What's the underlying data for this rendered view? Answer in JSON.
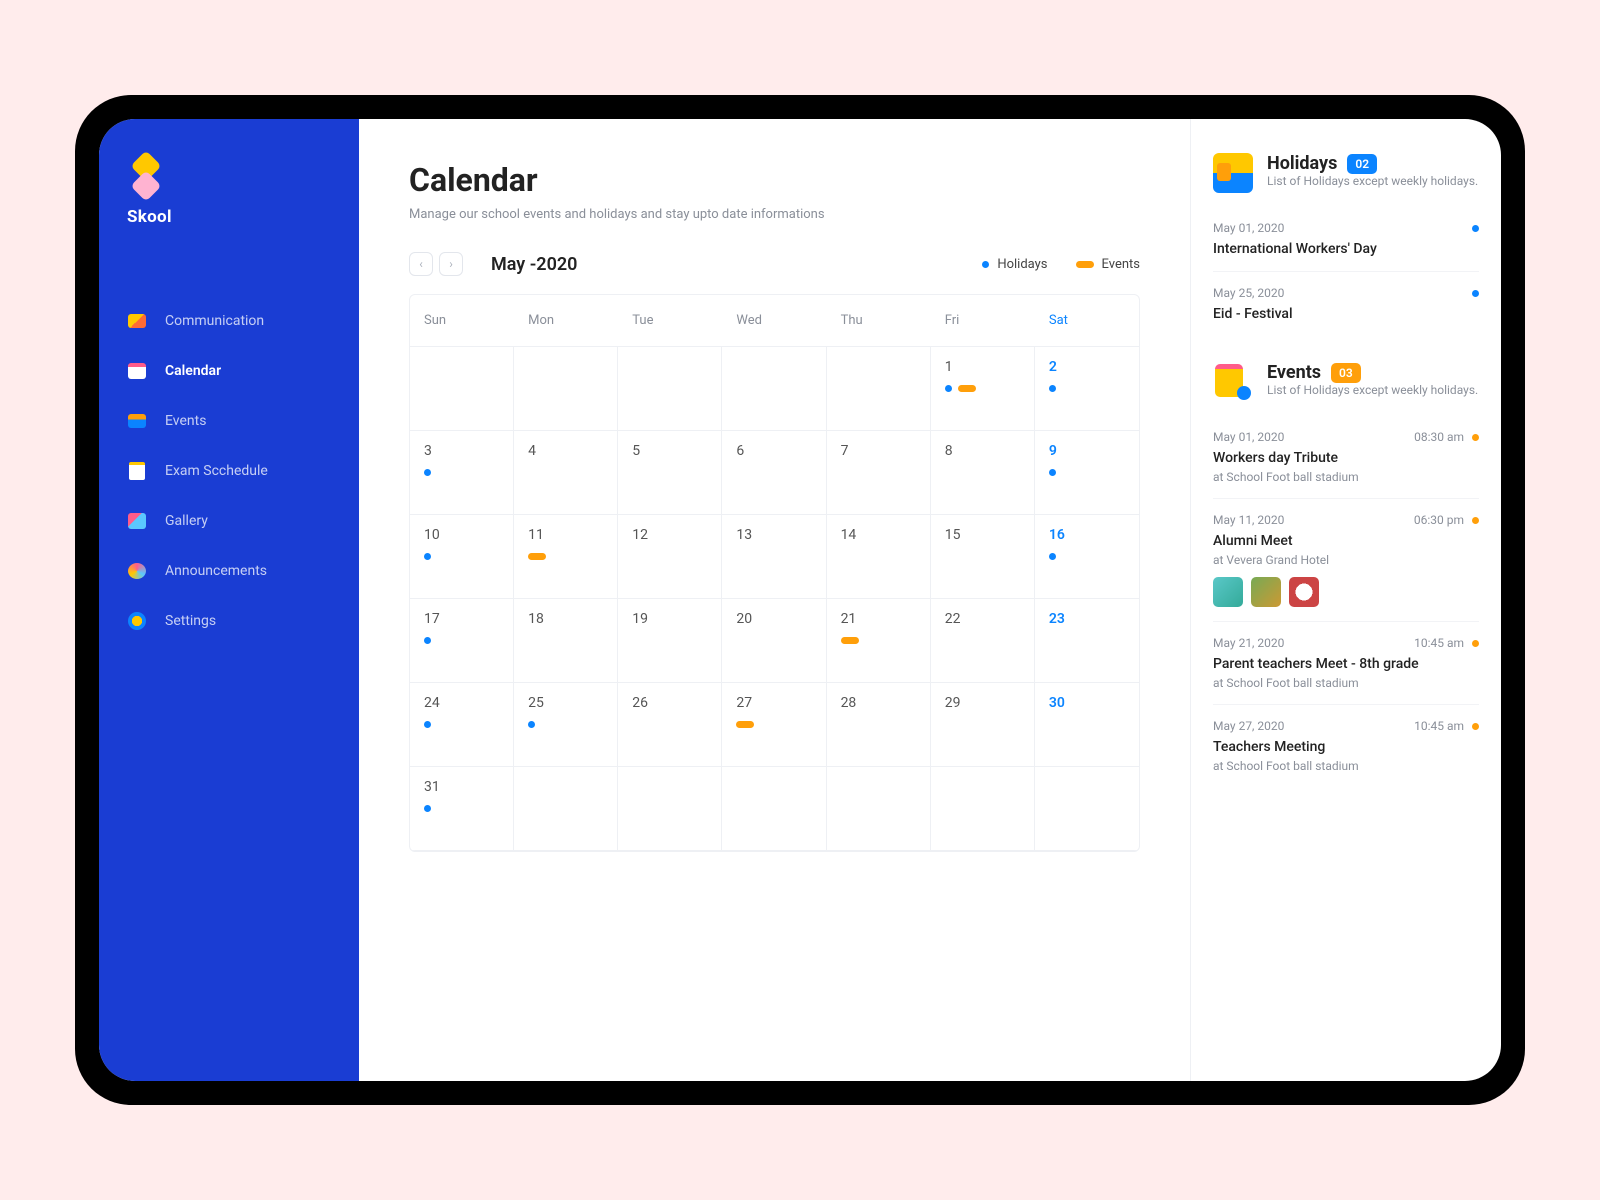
{
  "brand": "Skool",
  "nav": [
    {
      "label": "Communication"
    },
    {
      "label": "Calendar"
    },
    {
      "label": "Events"
    },
    {
      "label": "Exam Scchedule"
    },
    {
      "label": "Gallery"
    },
    {
      "label": "Announcements"
    },
    {
      "label": "Settings"
    }
  ],
  "page": {
    "title": "Calendar",
    "subtitle": "Manage our school events and holidays  and stay upto date informations",
    "month": "May -2020",
    "legend": {
      "holidays": "Holidays",
      "events": "Events"
    },
    "weekdays": [
      "Sun",
      "Mon",
      "Tue",
      "Wed",
      "Thu",
      "Fri",
      "Sat"
    ],
    "cells": [
      {
        "d": ""
      },
      {
        "d": ""
      },
      {
        "d": ""
      },
      {
        "d": ""
      },
      {
        "d": ""
      },
      {
        "d": "1",
        "hol": true,
        "ev": true
      },
      {
        "d": "2",
        "sat": true,
        "hol": true
      },
      {
        "d": "3",
        "hol": true
      },
      {
        "d": "4"
      },
      {
        "d": "5"
      },
      {
        "d": "6"
      },
      {
        "d": "7"
      },
      {
        "d": "8"
      },
      {
        "d": "9",
        "sat": true,
        "hol": true
      },
      {
        "d": "10",
        "hol": true
      },
      {
        "d": "11",
        "ev": true
      },
      {
        "d": "12"
      },
      {
        "d": "13"
      },
      {
        "d": "14"
      },
      {
        "d": "15"
      },
      {
        "d": "16",
        "sat": true,
        "hol": true
      },
      {
        "d": "17",
        "hol": true
      },
      {
        "d": "18"
      },
      {
        "d": "19"
      },
      {
        "d": "20"
      },
      {
        "d": "21",
        "ev": true
      },
      {
        "d": "22"
      },
      {
        "d": "23",
        "sat": true
      },
      {
        "d": "24",
        "hol": true
      },
      {
        "d": "25",
        "hol": true
      },
      {
        "d": "26"
      },
      {
        "d": "27",
        "ev": true
      },
      {
        "d": "28"
      },
      {
        "d": "29"
      },
      {
        "d": "30",
        "sat": true
      },
      {
        "d": "31",
        "hol": true
      },
      {
        "d": ""
      },
      {
        "d": ""
      },
      {
        "d": ""
      },
      {
        "d": ""
      },
      {
        "d": ""
      },
      {
        "d": ""
      }
    ]
  },
  "holidays": {
    "title": "Holidays",
    "count": "02",
    "sub": "List of Holidays except weekly holidays.",
    "items": [
      {
        "date": "May 01, 2020",
        "title": "International Workers' Day"
      },
      {
        "date": "May 25, 2020",
        "title": "Eid - Festival"
      }
    ]
  },
  "events": {
    "title": "Events",
    "count": "03",
    "sub": "List of Holidays except weekly holidays.",
    "items": [
      {
        "date": "May 01, 2020",
        "time": "08:30 am",
        "title": "Workers day Tribute",
        "loc": "at School Foot ball stadium"
      },
      {
        "date": "May 11, 2020",
        "time": "06:30 pm",
        "title": "Alumni Meet",
        "loc": "at Vevera Grand Hotel",
        "thumbs": true
      },
      {
        "date": "May 21, 2020",
        "time": "10:45 am",
        "title": "Parent teachers Meet - 8th grade",
        "loc": "at School Foot ball stadium"
      },
      {
        "date": "May 27, 2020",
        "time": "10:45 am",
        "title": "Teachers Meeting",
        "loc": "at School Foot ball stadium"
      }
    ]
  }
}
